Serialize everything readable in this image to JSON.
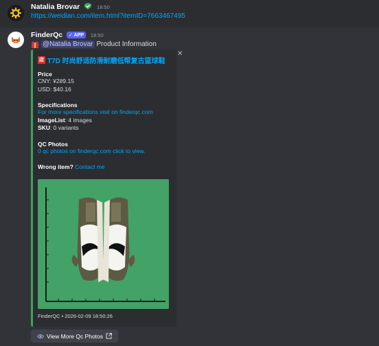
{
  "message1": {
    "author": "Natalia Brovar",
    "timestamp": "18:50",
    "link": "https://weidian.com/item.html?itemID=7663467495"
  },
  "message2": {
    "author": "FinderQc",
    "app_badge": "APP",
    "timestamp": "18:50",
    "mention": "@Natalia Brovar",
    "text": "Product Information"
  },
  "embed": {
    "accent_color": "#3aa55c",
    "title_icon": "店",
    "title": "T7D 时尚舒适防滑耐磨低帮复古篮球鞋",
    "price_label": "Price",
    "price_cny": "CNY: ¥289.15",
    "price_usd": "USD: $40.16",
    "spec_label": "Specifications",
    "spec_link": "For more specifications visit on finderqc.com",
    "imagelist_key": "ImageList",
    "imagelist_val": ": 4 images",
    "sku_key": "SKU",
    "sku_val": ": 0 variants",
    "qc_label": "QC Photos",
    "qc_link": "0 qc photos on finderqc.com click to view.",
    "wrong_label": "Wrong item?",
    "wrong_link": "Contact me",
    "footer": "FinderQC • 2026-02-09 18:50:26"
  },
  "button": {
    "label": "View More Qc Photos"
  }
}
